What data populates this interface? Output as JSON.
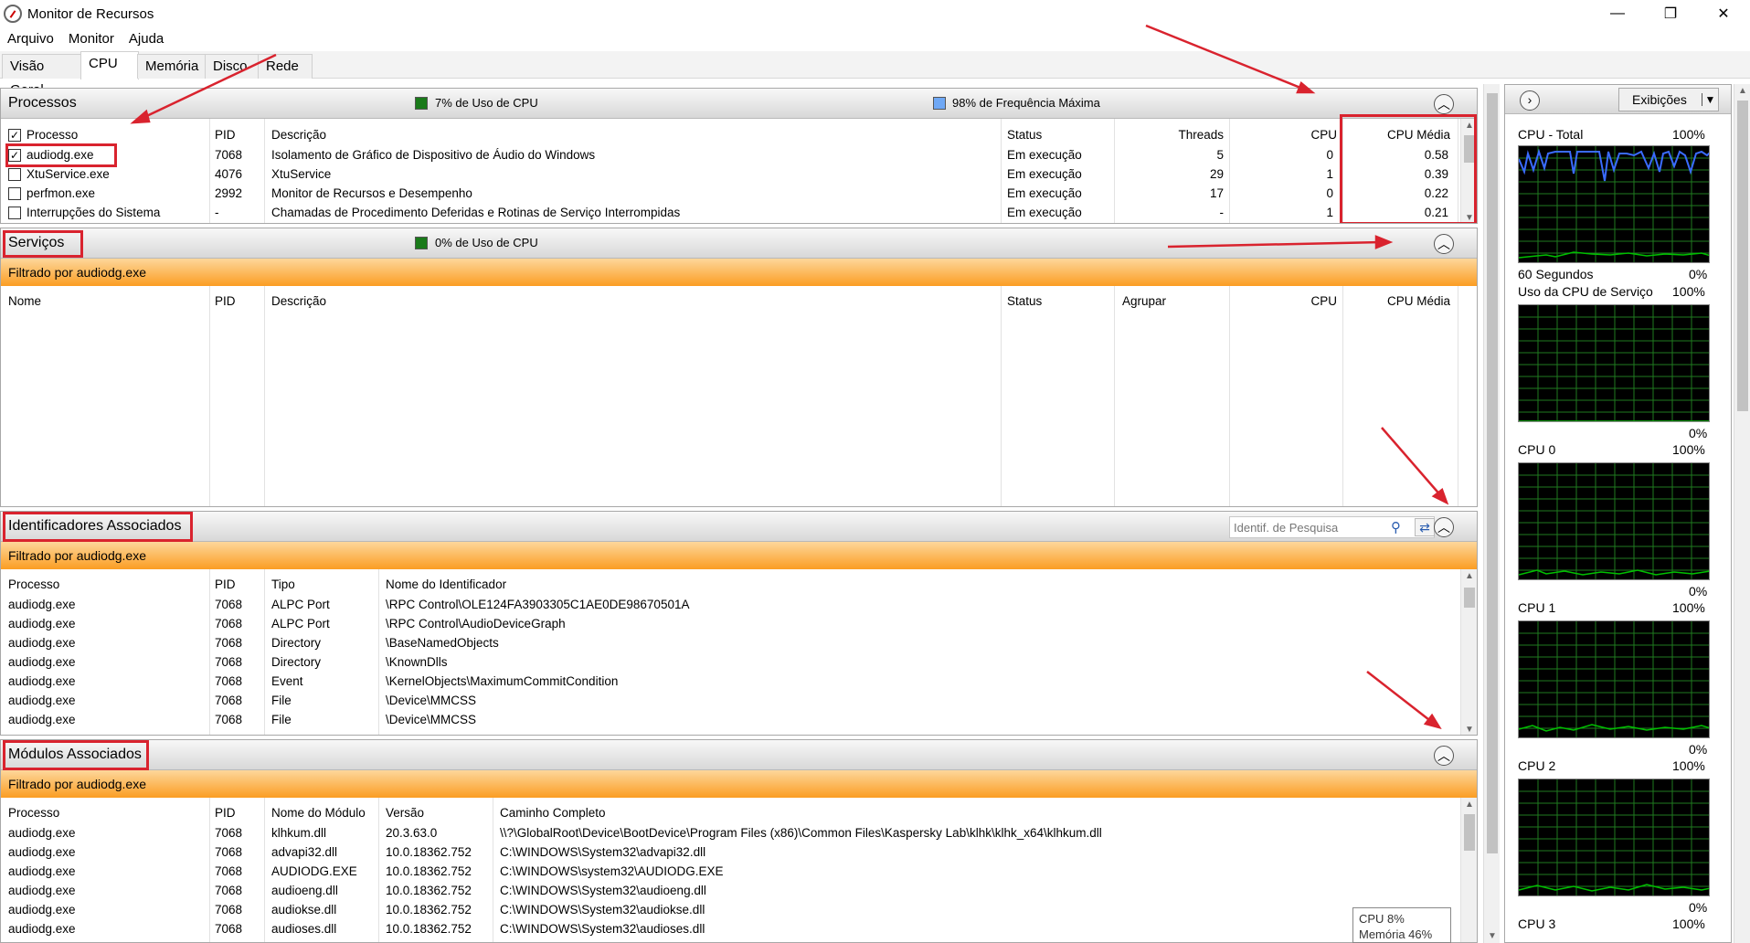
{
  "window": {
    "title": "Monitor de Recursos",
    "minimize": "—",
    "maximize": "❐",
    "close": "✕"
  },
  "menu": [
    "Arquivo",
    "Monitor",
    "Ajuda"
  ],
  "tabs": [
    "Visão Geral",
    "CPU",
    "Memória",
    "Disco",
    "Rede"
  ],
  "active_tab": "CPU",
  "colors": {
    "accent_red": "#d9232e",
    "orange_top": "#fdd79b",
    "orange_bottom": "#fb9d23",
    "graph_green": "#00c000",
    "graph_blue": "#3a6bff",
    "cpu_green": "#1a7a1a",
    "freq_blue": "#6fa8f5"
  },
  "processes": {
    "title": "Processos",
    "cpu_usage": "7% de Uso de CPU",
    "freq": "98% de Frequência Máxima",
    "headers": {
      "name": "Processo",
      "pid": "PID",
      "desc": "Descrição",
      "status": "Status",
      "threads": "Threads",
      "cpu": "CPU",
      "avg": "CPU Média"
    },
    "rows": [
      {
        "checked": true,
        "name": "audiodg.exe",
        "pid": "7068",
        "desc": "Isolamento de Gráfico de Dispositivo de Áudio do Windows",
        "status": "Em execução",
        "threads": "5",
        "cpu": "0",
        "avg": "0.58"
      },
      {
        "checked": false,
        "name": "XtuService.exe",
        "pid": "4076",
        "desc": "XtuService",
        "status": "Em execução",
        "threads": "29",
        "cpu": "1",
        "avg": "0.39"
      },
      {
        "checked": false,
        "name": "perfmon.exe",
        "pid": "2992",
        "desc": "Monitor de Recursos e Desempenho",
        "status": "Em execução",
        "threads": "17",
        "cpu": "0",
        "avg": "0.22"
      },
      {
        "checked": false,
        "name": "Interrupções do Sistema",
        "pid": "-",
        "desc": "Chamadas de Procedimento Deferidas e Rotinas de Serviço Interrompidas",
        "status": "Em execução",
        "threads": "-",
        "cpu": "1",
        "avg": "0.21"
      }
    ]
  },
  "services": {
    "title": "Serviços",
    "cpu_usage": "0% de Uso de CPU",
    "filter": "Filtrado por audiodg.exe",
    "headers": {
      "name": "Nome",
      "pid": "PID",
      "desc": "Descrição",
      "status": "Status",
      "group": "Agrupar",
      "cpu": "CPU",
      "avg": "CPU Média"
    }
  },
  "handles": {
    "title": "Identificadores Associados",
    "search_placeholder": "Identif. de Pesquisa",
    "filter": "Filtrado por audiodg.exe",
    "headers": {
      "proc": "Processo",
      "pid": "PID",
      "type": "Tipo",
      "name": "Nome do Identificador"
    },
    "rows": [
      {
        "proc": "audiodg.exe",
        "pid": "7068",
        "type": "ALPC Port",
        "name": "\\RPC Control\\OLE124FA3903305C1AE0DE98670501A"
      },
      {
        "proc": "audiodg.exe",
        "pid": "7068",
        "type": "ALPC Port",
        "name": "\\RPC Control\\AudioDeviceGraph"
      },
      {
        "proc": "audiodg.exe",
        "pid": "7068",
        "type": "Directory",
        "name": "\\BaseNamedObjects"
      },
      {
        "proc": "audiodg.exe",
        "pid": "7068",
        "type": "Directory",
        "name": "\\KnownDlls"
      },
      {
        "proc": "audiodg.exe",
        "pid": "7068",
        "type": "Event",
        "name": "\\KernelObjects\\MaximumCommitCondition"
      },
      {
        "proc": "audiodg.exe",
        "pid": "7068",
        "type": "File",
        "name": "\\Device\\MMCSS"
      },
      {
        "proc": "audiodg.exe",
        "pid": "7068",
        "type": "File",
        "name": "\\Device\\MMCSS"
      }
    ]
  },
  "modules": {
    "title": "Módulos Associados",
    "filter": "Filtrado por audiodg.exe",
    "headers": {
      "proc": "Processo",
      "pid": "PID",
      "name": "Nome do Módulo",
      "version": "Versão",
      "path": "Caminho Completo"
    },
    "rows": [
      {
        "proc": "audiodg.exe",
        "pid": "7068",
        "name": "klhkum.dll",
        "version": "20.3.63.0",
        "path": "\\\\?\\GlobalRoot\\Device\\BootDevice\\Program Files (x86)\\Common Files\\Kaspersky Lab\\klhk\\klhk_x64\\klhkum.dll"
      },
      {
        "proc": "audiodg.exe",
        "pid": "7068",
        "name": "advapi32.dll",
        "version": "10.0.18362.752",
        "path": "C:\\WINDOWS\\System32\\advapi32.dll"
      },
      {
        "proc": "audiodg.exe",
        "pid": "7068",
        "name": "AUDIODG.EXE",
        "version": "10.0.18362.752",
        "path": "C:\\WINDOWS\\system32\\AUDIODG.EXE"
      },
      {
        "proc": "audiodg.exe",
        "pid": "7068",
        "name": "audioeng.dll",
        "version": "10.0.18362.752",
        "path": "C:\\WINDOWS\\System32\\audioeng.dll"
      },
      {
        "proc": "audiodg.exe",
        "pid": "7068",
        "name": "audiokse.dll",
        "version": "10.0.18362.752",
        "path": "C:\\WINDOWS\\System32\\audiokse.dll"
      },
      {
        "proc": "audiodg.exe",
        "pid": "7068",
        "name": "audioses.dll",
        "version": "10.0.18362.752",
        "path": "C:\\WINDOWS\\System32\\audioses.dll"
      }
    ]
  },
  "right_panel": {
    "views_button": "Exibições",
    "graphs": [
      {
        "title": "CPU - Total",
        "max": "100%",
        "time": "60 Segundos",
        "min": "0%"
      },
      {
        "title": "Uso da CPU de Serviço",
        "max": "100%",
        "min": "0%"
      },
      {
        "title": "CPU 0",
        "max": "100%",
        "min": "0%"
      },
      {
        "title": "CPU 1",
        "max": "100%",
        "min": "0%"
      },
      {
        "title": "CPU 2",
        "max": "100%",
        "min": "0%"
      },
      {
        "title": "CPU 3",
        "max": "100%"
      }
    ]
  },
  "tooltip": {
    "cpu": "CPU 8%",
    "mem": "Memória 46%"
  }
}
